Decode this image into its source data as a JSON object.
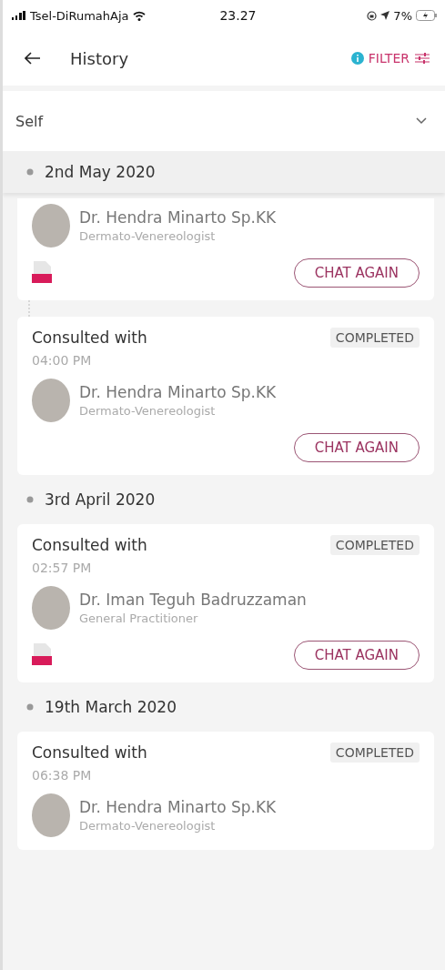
{
  "status_bar": {
    "carrier": "Tsel-DiRumahAja",
    "time": "23.27",
    "battery": "7%"
  },
  "header": {
    "title": "History",
    "filter": "FILTER",
    "filter_active": true
  },
  "profile_select": {
    "value": "Self"
  },
  "groups": [
    {
      "date": "2nd May 2020",
      "entries": [
        {
          "doctor": "Dr. Hendra Minarto Sp.KK",
          "specialty": "Dermato-Venereologist",
          "prescription": true,
          "button": "CHAT AGAIN"
        },
        {
          "label": "Consulted with",
          "time": "04:00 PM",
          "status": "COMPLETED",
          "doctor": "Dr. Hendra Minarto Sp.KK",
          "specialty": "Dermato-Venereologist",
          "prescription": false,
          "button": "CHAT AGAIN"
        }
      ]
    },
    {
      "date": "3rd April 2020",
      "entries": [
        {
          "label": "Consulted with",
          "time": "02:57 PM",
          "status": "COMPLETED",
          "doctor": "Dr. Iman Teguh Badruzzaman",
          "specialty": "General Practitioner",
          "prescription": true,
          "button": "CHAT AGAIN"
        }
      ]
    },
    {
      "date": "19th March 2020",
      "entries": [
        {
          "label": "Consulted with",
          "time": "06:38 PM",
          "status": "COMPLETED",
          "doctor": "Dr. Hendra Minarto Sp.KK",
          "specialty": "Dermato-Venereologist",
          "prescription": false
        }
      ]
    }
  ]
}
